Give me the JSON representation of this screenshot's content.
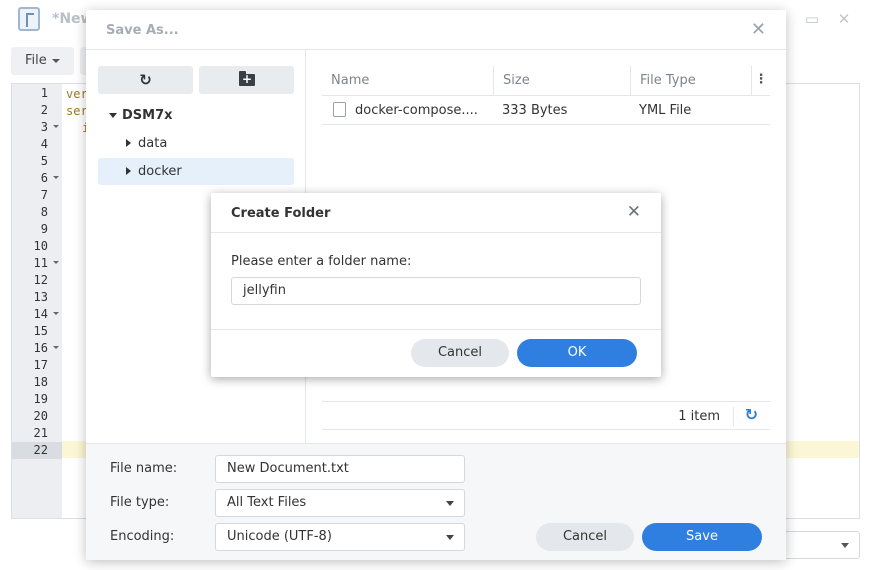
{
  "editor": {
    "title": "*New",
    "file_menu_label": "File",
    "line_numbers": [
      "1",
      "2",
      "3",
      "4",
      "5",
      "6",
      "7",
      "8",
      "9",
      "10",
      "11",
      "12",
      "13",
      "14",
      "15",
      "16",
      "17",
      "18",
      "19",
      "20",
      "21",
      "22"
    ],
    "fold_lines": [
      "3",
      "6",
      "11",
      "14",
      "16"
    ],
    "active_line": "22",
    "code_fragments": [
      "ver",
      "ser",
      "i"
    ]
  },
  "save_dialog": {
    "title": "Save As...",
    "tree": {
      "root": "DSM7x",
      "children": [
        "data",
        "docker"
      ],
      "selected": "docker"
    },
    "columns": [
      "Name",
      "Size",
      "File Type"
    ],
    "files": [
      {
        "name": "docker-compose....",
        "size": "333 Bytes",
        "type": "YML File"
      }
    ],
    "item_count": "1 item",
    "labels": {
      "file_name": "File name:",
      "file_type": "File type:",
      "encoding": "Encoding:"
    },
    "values": {
      "file_name": "New Document.txt",
      "file_type": "All Text Files",
      "encoding": "Unicode (UTF-8)"
    },
    "cancel_label": "Cancel",
    "save_label": "Save"
  },
  "create_folder": {
    "title": "Create Folder",
    "prompt": "Please enter a folder name:",
    "value": "jellyfin",
    "cancel_label": "Cancel",
    "ok_label": "OK"
  },
  "colors": {
    "accent": "#2f7fe0",
    "selected_bg": "#e6f0fb",
    "active_line": "#fbf7d6"
  }
}
